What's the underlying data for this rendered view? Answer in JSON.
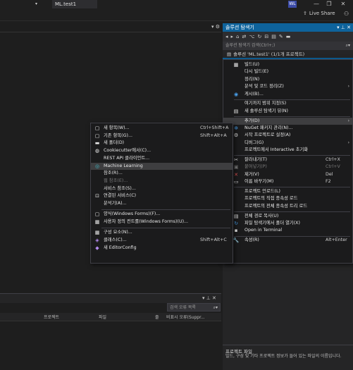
{
  "titlebar": {
    "solution_name": "ML.test1",
    "avatar_initials": "WL",
    "minimize": "—",
    "restore": "❐",
    "close": "✕"
  },
  "toolbar": {
    "live_share": "Live Share"
  },
  "solution_explorer": {
    "title": "솔루션 탐색기",
    "search_placeholder": "솔루션 탐색기 검색(Ctrl+;)",
    "root_label": "솔루션 'ML.test1' (1/1개 프로젝트)",
    "desc_title": "프로젝트 파일",
    "desc_text": "빌드, 구성 및 기타 프로젝트 정보가 들어 있는 파일의 이름입니다."
  },
  "bottom_panel": {
    "search_placeholder": "검색 오류 목록",
    "columns": [
      "프로젝트",
      "파일",
      "줄",
      "비표시 오류(Suppr..."
    ]
  },
  "context_menu": [
    {
      "icon": "build-icon",
      "glyph": "▦",
      "label": "빌드(U)",
      "shortcut": "",
      "sub": false
    },
    {
      "icon": "",
      "glyph": "",
      "label": "다시 빌드(E)",
      "shortcut": "",
      "sub": false
    },
    {
      "icon": "",
      "glyph": "",
      "label": "정리(N)",
      "shortcut": "",
      "sub": false
    },
    {
      "icon": "",
      "glyph": "",
      "label": "분석 및 코드 정리(Z)",
      "shortcut": "",
      "sub": true
    },
    {
      "icon": "publish-icon",
      "glyph": "◉",
      "label": "게시(B)...",
      "shortcut": "",
      "sub": false
    },
    {
      "sep": true
    },
    {
      "icon": "",
      "glyph": "",
      "label": "여기까지 범위 지정(S)",
      "shortcut": "",
      "sub": false
    },
    {
      "icon": "new-view-icon",
      "glyph": "▤",
      "label": "새 솔루션 탐색기 뷰(N)",
      "shortcut": "",
      "sub": false
    },
    {
      "sep": true
    },
    {
      "icon": "",
      "glyph": "",
      "label": "추가(D)",
      "shortcut": "",
      "sub": true,
      "hl": true
    },
    {
      "icon": "nuget-icon",
      "glyph": "✲",
      "label": "NuGet 패키지 관리(N)...",
      "shortcut": "",
      "sub": false
    },
    {
      "icon": "gear-icon",
      "glyph": "⚙",
      "label": "시작 프로젝트로 설정(A)",
      "shortcut": "",
      "sub": false
    },
    {
      "icon": "",
      "glyph": "",
      "label": "디버그(G)",
      "shortcut": "",
      "sub": true
    },
    {
      "icon": "",
      "glyph": "",
      "label": "프로젝트에서 Interactive 초기화",
      "shortcut": "",
      "sub": false
    },
    {
      "sep": true
    },
    {
      "icon": "cut-icon",
      "glyph": "✂",
      "label": "잘라내기(T)",
      "shortcut": "Ctrl+X",
      "sub": false
    },
    {
      "icon": "paste-icon",
      "glyph": "▣",
      "label": "붙여넣기(P)",
      "shortcut": "Ctrl+V",
      "sub": false,
      "dis": true
    },
    {
      "icon": "delete-icon",
      "glyph": "✕",
      "label": "제거(V)",
      "shortcut": "Del",
      "sub": false,
      "red": true
    },
    {
      "icon": "rename-icon",
      "glyph": "▭",
      "label": "이름 바꾸기(M)",
      "shortcut": "F2",
      "sub": false
    },
    {
      "sep": true
    },
    {
      "icon": "",
      "glyph": "",
      "label": "프로젝트 언로드(L)",
      "shortcut": "",
      "sub": false
    },
    {
      "icon": "",
      "glyph": "",
      "label": "프로젝트의 직접 종속성 로드",
      "shortcut": "",
      "sub": false
    },
    {
      "icon": "",
      "glyph": "",
      "label": "프로젝트의 전체 종속성 트리 로드",
      "shortcut": "",
      "sub": false
    },
    {
      "sep": true
    },
    {
      "icon": "copy-path-icon",
      "glyph": "▤",
      "label": "전체 경로 복사(U)",
      "shortcut": "",
      "sub": false
    },
    {
      "icon": "refresh-icon",
      "glyph": "↻",
      "label": "파일 탐색기에서 폴더 열기(X)",
      "shortcut": "",
      "sub": false
    },
    {
      "icon": "terminal-icon",
      "glyph": "▪",
      "label": "Open in Terminal",
      "shortcut": "",
      "sub": false
    },
    {
      "sep": true
    },
    {
      "icon": "wrench-icon",
      "glyph": "🔧",
      "label": "속성(R)",
      "shortcut": "Alt+Enter",
      "sub": false
    }
  ],
  "add_menu": [
    {
      "icon": "new-item-icon",
      "glyph": "▢",
      "label": "새 항목(W)...",
      "shortcut": "Ctrl+Shift+A"
    },
    {
      "icon": "existing-item-icon",
      "glyph": "▢",
      "label": "기존 항목(G)...",
      "shortcut": "Shift+Alt+A"
    },
    {
      "icon": "folder-icon",
      "glyph": "▬",
      "label": "새 폴더(D)",
      "shortcut": ""
    },
    {
      "icon": "cookiecutter-icon",
      "glyph": "◍",
      "label": "Cookiecutter에서(C)...",
      "shortcut": ""
    },
    {
      "icon": "",
      "glyph": "",
      "label": "REST API 클라이언트...",
      "shortcut": ""
    },
    {
      "icon": "ml-icon",
      "glyph": "◎",
      "label": "Machine Learning",
      "shortcut": "",
      "hl": true
    },
    {
      "icon": "",
      "glyph": "",
      "label": "참조(R)...",
      "shortcut": ""
    },
    {
      "icon": "",
      "glyph": "",
      "label": "웹 참조(E)...",
      "shortcut": "",
      "dis": true
    },
    {
      "icon": "",
      "glyph": "",
      "label": "서비스 참조(S)...",
      "shortcut": ""
    },
    {
      "icon": "connected-service-icon",
      "glyph": "⊡",
      "label": "연결된 서비스(C)",
      "shortcut": ""
    },
    {
      "icon": "",
      "glyph": "",
      "label": "분석기(A)...",
      "shortcut": ""
    },
    {
      "sep": true
    },
    {
      "icon": "form-icon",
      "glyph": "▢",
      "label": "양식(Windows Forms)(F)...",
      "shortcut": ""
    },
    {
      "icon": "user-control-icon",
      "glyph": "▦",
      "label": "사용자 정의 컨트롤(Windows Forms)(U)...",
      "shortcut": ""
    },
    {
      "sep": true
    },
    {
      "icon": "component-icon",
      "glyph": "▦",
      "label": "구성 요소(N)...",
      "shortcut": ""
    },
    {
      "icon": "class-icon",
      "glyph": "◈",
      "label": "클래스(C)...",
      "shortcut": "Shift+Alt+C"
    },
    {
      "icon": "editorconfig-icon",
      "glyph": "◆",
      "label": "새 EditorConfig",
      "shortcut": ""
    }
  ]
}
